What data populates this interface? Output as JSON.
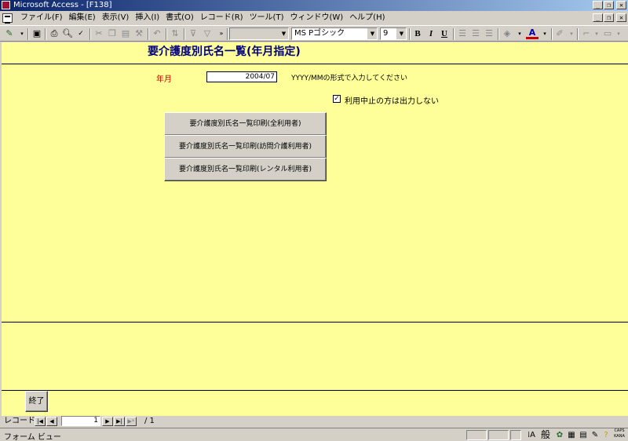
{
  "window": {
    "title": "Microsoft Access - [F138]",
    "buttons": [
      "_",
      "❐",
      "✕"
    ]
  },
  "menu": {
    "items": [
      "ファイル(F)",
      "編集(E)",
      "表示(V)",
      "挿入(I)",
      "書式(O)",
      "レコード(R)",
      "ツール(T)",
      "ウィンドウ(W)",
      "ヘルプ(H)"
    ],
    "child_buttons": [
      "_",
      "❐",
      "✕"
    ]
  },
  "toolbar": {
    "object_combo": "",
    "font_combo": "MS Pゴシック",
    "size_combo": "9",
    "bold": "B",
    "italic": "I",
    "underline": "U"
  },
  "form": {
    "title": "要介護度別氏名一覧(年月指定)",
    "year_label": "年月",
    "year_value": "2004/07",
    "hint": "YYYY/MMの形式で入力してください",
    "exclude_checked": true,
    "exclude_label": "利用中止の方は出力しない",
    "buttons": [
      "要介護度別氏名一覧印刷(全利用者)",
      "要介護度別氏名一覧印刷(訪問介護利用者)",
      "要介護度別氏名一覧印刷(レンタル利用者)"
    ],
    "end_button": "終了"
  },
  "record_nav": {
    "label": "レコード:",
    "current": "1",
    "total": "/ 1"
  },
  "status": {
    "text": "フォーム ビュー",
    "ime_mode": "般",
    "caps": "CAPS",
    "kana": "KANA"
  },
  "colors": {
    "form_background": "#ffff99",
    "title_text": "#000080",
    "label_red": "#cc0000"
  }
}
